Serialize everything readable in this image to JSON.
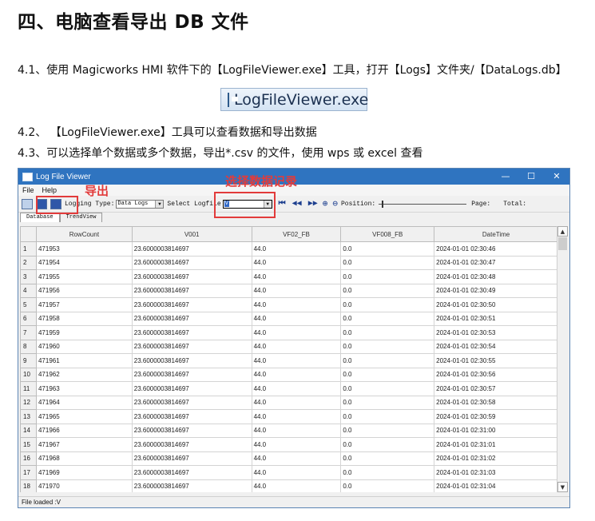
{
  "heading": "四、电脑查看导出 DB 文件",
  "paragraphs": {
    "p1": "4.1、使用 Magicworks HMI 软件下的【LogFileViewer.exe】工具，打开【Logs】文件夹/【DataLogs.db】",
    "p2": "4.2、 【LogFileViewer.exe】工具可以查看数据和导出数据",
    "p3": "4.3、可以选择单个数据或多个数据，导出*.csv 的文件，使用 wps 或 excel 查看"
  },
  "exe_button_label": "LogFileViewer.exe",
  "annotations": {
    "export": "导出",
    "select_record": "选择数据记录"
  },
  "window": {
    "title": "Log File Viewer",
    "controls": [
      "—",
      "☐",
      "✕"
    ],
    "menu": [
      "File",
      "Help"
    ],
    "toolbar": {
      "logging_type_label": "Logging Type:",
      "logging_type_value": "Data Logs",
      "select_logfile_label": "Select Logfile",
      "select_logfile_value": "V",
      "position_label": "Position:",
      "page_label": "Page:",
      "total_label": "Total:"
    },
    "tabs": [
      "Database",
      "TrendView"
    ],
    "columns": [
      "RowCount",
      "V001",
      "VF02_FB",
      "VF008_FB",
      "DateTime"
    ],
    "rows": [
      [
        "1",
        "471953",
        "23.6000003814697",
        "44.0",
        "0.0",
        "2024-01-01 02:30:46"
      ],
      [
        "2",
        "471954",
        "23.6000003814697",
        "44.0",
        "0.0",
        "2024-01-01 02:30:47"
      ],
      [
        "3",
        "471955",
        "23.6000003814697",
        "44.0",
        "0.0",
        "2024-01-01 02:30:48"
      ],
      [
        "4",
        "471956",
        "23.6000003814697",
        "44.0",
        "0.0",
        "2024-01-01 02:30:49"
      ],
      [
        "5",
        "471957",
        "23.6000003814697",
        "44.0",
        "0.0",
        "2024-01-01 02:30:50"
      ],
      [
        "6",
        "471958",
        "23.6000003814697",
        "44.0",
        "0.0",
        "2024-01-01 02:30:51"
      ],
      [
        "7",
        "471959",
        "23.6000003814697",
        "44.0",
        "0.0",
        "2024-01-01 02:30:53"
      ],
      [
        "8",
        "471960",
        "23.6000003814697",
        "44.0",
        "0.0",
        "2024-01-01 02:30:54"
      ],
      [
        "9",
        "471961",
        "23.6000003814697",
        "44.0",
        "0.0",
        "2024-01-01 02:30:55"
      ],
      [
        "10",
        "471962",
        "23.6000003814697",
        "44.0",
        "0.0",
        "2024-01-01 02:30:56"
      ],
      [
        "11",
        "471963",
        "23.6000003814697",
        "44.0",
        "0.0",
        "2024-01-01 02:30:57"
      ],
      [
        "12",
        "471964",
        "23.6000003814697",
        "44.0",
        "0.0",
        "2024-01-01 02:30:58"
      ],
      [
        "13",
        "471965",
        "23.6000003814697",
        "44.0",
        "0.0",
        "2024-01-01 02:30:59"
      ],
      [
        "14",
        "471966",
        "23.6000003814697",
        "44.0",
        "0.0",
        "2024-01-01 02:31:00"
      ],
      [
        "15",
        "471967",
        "23.6000003814697",
        "44.0",
        "0.0",
        "2024-01-01 02:31:01"
      ],
      [
        "16",
        "471968",
        "23.6000003814697",
        "44.0",
        "0.0",
        "2024-01-01 02:31:02"
      ],
      [
        "17",
        "471969",
        "23.6000003814697",
        "44.0",
        "0.0",
        "2024-01-01 02:31:03"
      ],
      [
        "18",
        "471970",
        "23.6000003814697",
        "44.0",
        "0.0",
        "2024-01-01 02:31:04"
      ]
    ],
    "status": "File loaded :V"
  },
  "colors": {
    "annotation_red": "#e23b3b",
    "titlebar_blue": "#2f74c0"
  }
}
